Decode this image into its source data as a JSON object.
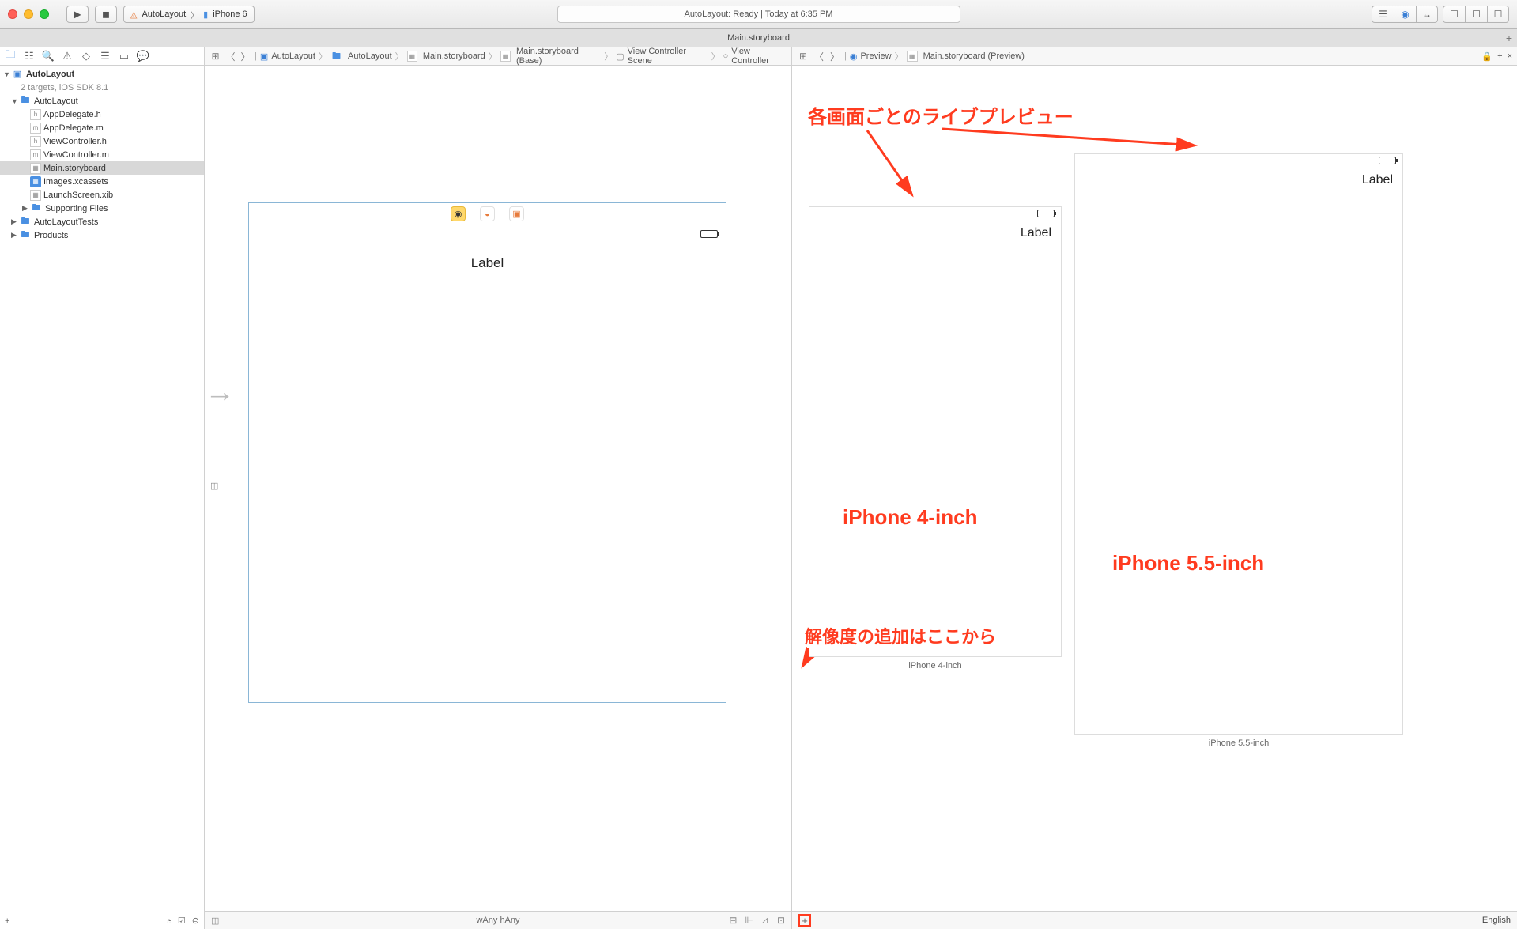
{
  "titlebar": {
    "scheme_target": "AutoLayout",
    "scheme_device": "iPhone 6",
    "status_text": "AutoLayout: Ready  |  Today at 6:35 PM"
  },
  "tabbar": {
    "title": "Main.storyboard"
  },
  "nav": {
    "project": "AutoLayout",
    "project_sub": "2 targets, iOS SDK 8.1",
    "group1": "AutoLayout",
    "files": {
      "f1": "AppDelegate.h",
      "f2": "AppDelegate.m",
      "f3": "ViewController.h",
      "f4": "ViewController.m",
      "f5": "Main.storyboard",
      "f6": "Images.xcassets",
      "f7": "LaunchScreen.xib",
      "f8": "Supporting Files"
    },
    "group2": "AutoLayoutTests",
    "group3": "Products"
  },
  "jumpbar_left": {
    "p1": "AutoLayout",
    "p2": "AutoLayout",
    "p3": "Main.storyboard",
    "p4": "Main.storyboard (Base)",
    "p5": "View Controller Scene",
    "p6": "View Controller"
  },
  "jumpbar_right": {
    "p1": "Preview",
    "p2": "Main.storyboard (Preview)"
  },
  "canvas": {
    "label_text": "Label",
    "size_class": "wAny hAny"
  },
  "preview": {
    "label_text1": "Label",
    "label_text2": "Label",
    "caption1": "iPhone 4-inch",
    "caption2": "iPhone 5.5-inch",
    "language": "English"
  },
  "annotations": {
    "live_preview": "各画面ごとのライブプレビュー",
    "iphone4": "iPhone 4-inch",
    "iphone55": "iPhone 5.5-inch",
    "resolution_add": "解像度の追加はここから"
  }
}
